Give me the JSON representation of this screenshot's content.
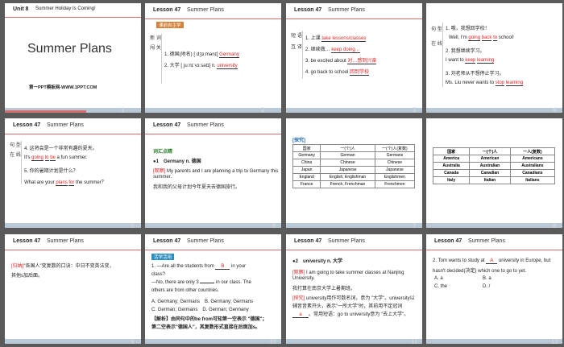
{
  "slides": [
    {
      "num": "1",
      "unit": "Unit 8",
      "unit_title": "Summer Holiday Is Coming!",
      "title": "Summer Plans",
      "footer": "第一PPT模板网-WWW.1PPT.COM"
    },
    {
      "num": "2",
      "lesson": "Lesson 47",
      "topic": "Summer Plans",
      "tag": "课前自主学",
      "side": "新 词 闯 关",
      "line1": "1. 德国(地名) [ˈdʒɜːmənɪ] ",
      "ans1": "Germany",
      "line2": "2. 大学 [ˌjuːnɪˈvɜːsətɪ] n. ",
      "ans2": "university"
    },
    {
      "num": "3",
      "lesson": "Lesson 47",
      "topic": "Summer Plans",
      "side": "短 语 互 译",
      "items": [
        {
          "q": "1. 上课 ",
          "a": "take lessons/classes"
        },
        {
          "q": "2. 继续做… ",
          "a": "keep doing…"
        },
        {
          "q": "3. be excited about ",
          "a": "对…感到兴奋"
        },
        {
          "q": "4. go back to school ",
          "a": "回到学校"
        }
      ]
    },
    {
      "num": "4",
      "lesson": "Lesson 47",
      "topic": "Summer Plans",
      "side": "句 型 在 线",
      "l1": "1. 哦，我想回学校！",
      "l2a": "Well, I'm ",
      "a1": "going",
      "a2": "back",
      "a3": "to",
      "l2b": " school!",
      "l3": "2. 我想继续学习。",
      "l4a": "I want to ",
      "a4": "keep",
      "a5": "learning",
      "l5": "3. 刘老师从不想停止学习。",
      "l6a": "Ms. Liu never wants to ",
      "a6": "stop",
      "a7": "learning"
    },
    {
      "num": "5",
      "lesson": "Lesson 47",
      "topic": "Summer Plans",
      "side": "句 型 在 线",
      "l1": "4. 这将会是一个非常有趣的夏天。",
      "l2a": "It's ",
      "a1": "going",
      "a2": "to",
      "a3": "be",
      "l2b": " a fun summer.",
      "l3": "5. 你的暑期计划是什么？",
      "l4a": "What are your ",
      "a4": "plans",
      "a5": "for",
      "l4b": " the summer？"
    },
    {
      "num": "6",
      "lesson": "Lesson 47",
      "topic": "Summer Plans",
      "tag": "词汇点睛",
      "head": "●1　Germany n. 德国",
      "ex_tag": "[观察]",
      "ex1": "My parents and I are planning a trip to Germany this",
      "ex2": "summer.",
      "ex3": "我和我的父母计划今年夏天去德国旅行。"
    },
    {
      "num": "7",
      "tag": "[探究]",
      "headers": [
        "国家",
        "一(个)人",
        "一(个)人(复数)"
      ],
      "rows": [
        [
          "Germany",
          "German",
          "Germans"
        ],
        [
          "China",
          "Chinese",
          "Chinese"
        ],
        [
          "Japan",
          "Japanese",
          "Japanese"
        ],
        [
          "England",
          "English, Englishman",
          "Englishmen"
        ],
        [
          "France",
          "French, Frenchman",
          "Frenchmen"
        ]
      ]
    },
    {
      "num": "8",
      "headers": [
        "国家",
        "一(个)人",
        "一人(复数)"
      ],
      "rows": [
        [
          "America",
          "American",
          "Americans"
        ],
        [
          "Australia",
          "Australian",
          "Australians"
        ],
        [
          "Canada",
          "Canadian",
          "Canadians"
        ],
        [
          "Italy",
          "Italian",
          "Italians"
        ]
      ]
    },
    {
      "num": "9",
      "lesson": "Lesson 47",
      "topic": "Summer Plans",
      "tag": "[归纳]",
      "l1": "\"各国人\"变复数的口诀：中日不变英法变，",
      "l2": "其他s加后面。"
    },
    {
      "num": "10",
      "lesson": "Lesson 47",
      "topic": "Summer Plans",
      "tag": "活学活用",
      "q1a": "1. —Are all the students from ",
      "q1ans": "B",
      "q1b": " in your",
      "q2": "class?",
      "q3a": "—No, there are only 3 ",
      "q3b": " in our class. The",
      "q4": "others are from other countries.",
      "o1": "A. Germany; Germans　B. Germany; Germans",
      "o2": "C. German; Germans　D. German; Germany",
      "e1": "【解析】由同句中的be from可知第一空表示 \"德国\"；",
      "e2": "第二空表示\"德国人\"，其复数形式直接在后面加s。"
    },
    {
      "num": "11",
      "lesson": "Lesson 47",
      "topic": "Summer Plans",
      "head": "●2　university n. 大学",
      "ex_tag": "[观察]",
      "ex1": "I am going to take summer classes at Nanjing",
      "ex2": "University.",
      "ex3": "我打算在南京大学上暑期班。",
      "ex_tag2": "[探究]",
      "ex4": "university用作可数名词，意为 \"大学\"。university以",
      "ex5": "辅音音素开头，表示\"一所大学\"时，其前用不定冠词",
      "ans": "a",
      "ex6": "。常用短语：go to university意为 \"去上大学\"。"
    },
    {
      "num": "12",
      "lesson": "Lesson 47",
      "topic": "Summer Plans",
      "l1a": "2. Tom wants to study at ",
      "ans": "A",
      "l1b": " university in Europe, but",
      "l2": "hasn't decided(决定) which one to go to yet.",
      "o1": "A. a",
      "o2": "B. a",
      "o3": "C. the",
      "o4": "D. /"
    }
  ]
}
